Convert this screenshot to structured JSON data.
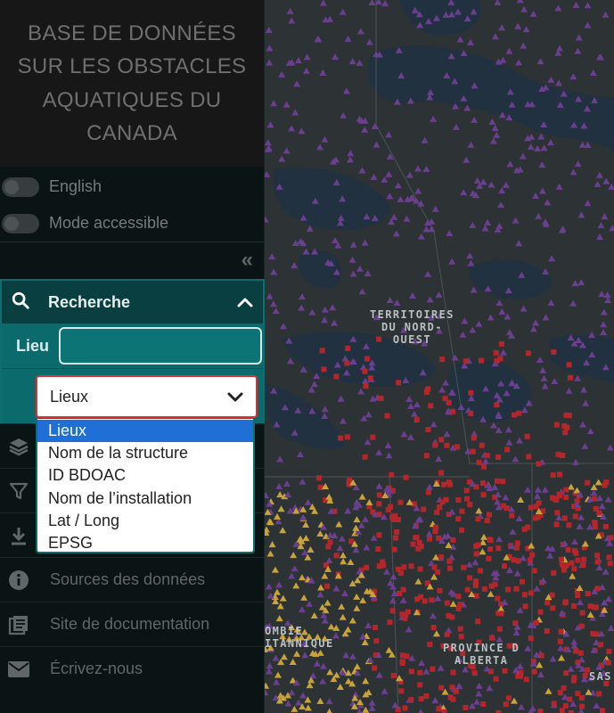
{
  "sidebar": {
    "title": "BASE DE DONNÉES SUR LES OBSTACLES AQUATIQUES DU CANADA",
    "toggles": [
      {
        "label": "English",
        "on": false
      },
      {
        "label": "Mode accessible",
        "on": false
      }
    ],
    "collapse_icon": "double-chevron-left-icon",
    "search": {
      "header_label": "Recherche",
      "icon": "search-icon",
      "expanded": true,
      "lieu_label": "Lieu",
      "lieu_value": "",
      "select_value": "Lieux",
      "options": [
        "Lieux",
        "Nom de la structure",
        "ID BDOAC",
        "Nom de l’installation",
        "Lat / Long",
        "EPSG"
      ],
      "highlighted_option": "Lieux"
    },
    "menu": [
      {
        "label": "",
        "icon": "layers-icon"
      },
      {
        "label": "",
        "icon": "filter-icon"
      },
      {
        "label": "",
        "icon": "download-icon"
      },
      {
        "label": "Sources des données",
        "icon": "info-icon"
      },
      {
        "label": "Site de documentation",
        "icon": "document-icon"
      },
      {
        "label": "Écrivez-nous",
        "icon": "mail-icon"
      }
    ]
  },
  "map": {
    "labels": {
      "nwt": [
        "TERRITOIRES",
        "DU NORD-",
        "OUEST"
      ],
      "bc": [
        "OMBIE",
        "ITANNIQUE"
      ],
      "ab": [
        "PROVINCE D",
        "ALBERTA"
      ],
      "sk": [
        "SAS"
      ]
    },
    "marker_colors": {
      "triangle": "#6a3f8f",
      "square": "#b3262b",
      "dam": "#c8a23a"
    }
  }
}
